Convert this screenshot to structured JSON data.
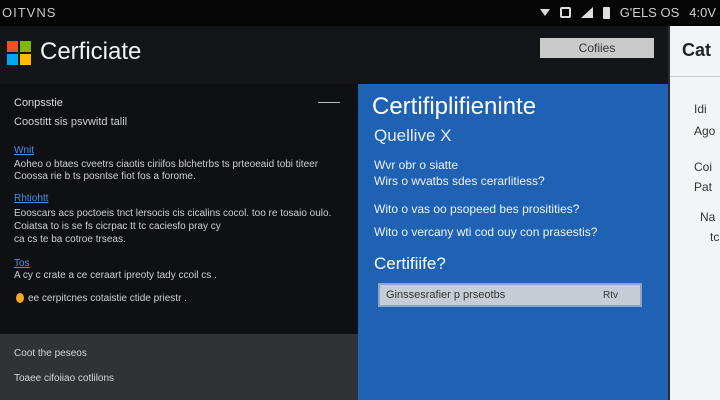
{
  "status_bar": {
    "left_text": "OITVNS",
    "right_text": "G'ELS OS",
    "clock": "4:0V",
    "icons": [
      "dropdown-arrow-icon",
      "screenshot-icon",
      "signal-icon",
      "battery-icon"
    ]
  },
  "header": {
    "title": "Cerficiate",
    "button_label": "Cofiies"
  },
  "left_panel": {
    "header": "Conpsstie",
    "intro": "Coostitt sis psvwitd talil",
    "section1": {
      "link": "Wnit",
      "lines": [
        "Aoheo o btaes cveetrs ciaotis ciriifos blchetrbs ts prteoeaid tobi titeer",
        "Coossa rie b ts posntse fiot fos a forome."
      ]
    },
    "section2": {
      "link": "Rhtiohtt",
      "lines": [
        "Eooscars acs poctoeis tnct lersocis cis cicalins cocol. too re tosaio oulo.",
        "Coiatsa to is se fs cicrpac tt tc caciesfo pray cy",
        "ca cs te ba cotroe trseas."
      ]
    },
    "section3": {
      "link": "Tos",
      "lines": [
        "A cy c crate a ce ceraart ipreoty tady ccoil cs ."
      ]
    },
    "status_line": "ee cerpitcnes cotaistie ctide priestr .",
    "footer": [
      "Coot the peseos",
      "Toaee cifoiiao cotlilons"
    ]
  },
  "center_panel": {
    "title": "Certifiplifieninte",
    "subtitle": "Quellive X",
    "questions": [
      "Wvr obr o siatte",
      "Wirs o wvatbs sdes cerarlitiess?",
      "Wito o vas oo psopeed bes prositities?",
      "Wito o vercany wti cod ouy con prasestis?"
    ],
    "cert_question": "Certifiife?",
    "cert_input_value": "Ginssesrafier p prseotbs",
    "cert_input_action": "Rtv"
  },
  "right_panel": {
    "title": "Cat",
    "items": [
      "Idi",
      "Ago",
      "Coi",
      "Pat",
      "Na",
      "tc"
    ]
  },
  "colors": {
    "center_blue": "#1f62b4",
    "link_blue": "#4a8fe8",
    "status_orange": "#f5a623",
    "logo": [
      "#f25022",
      "#7fba00",
      "#00a4ef",
      "#ffb900"
    ]
  }
}
